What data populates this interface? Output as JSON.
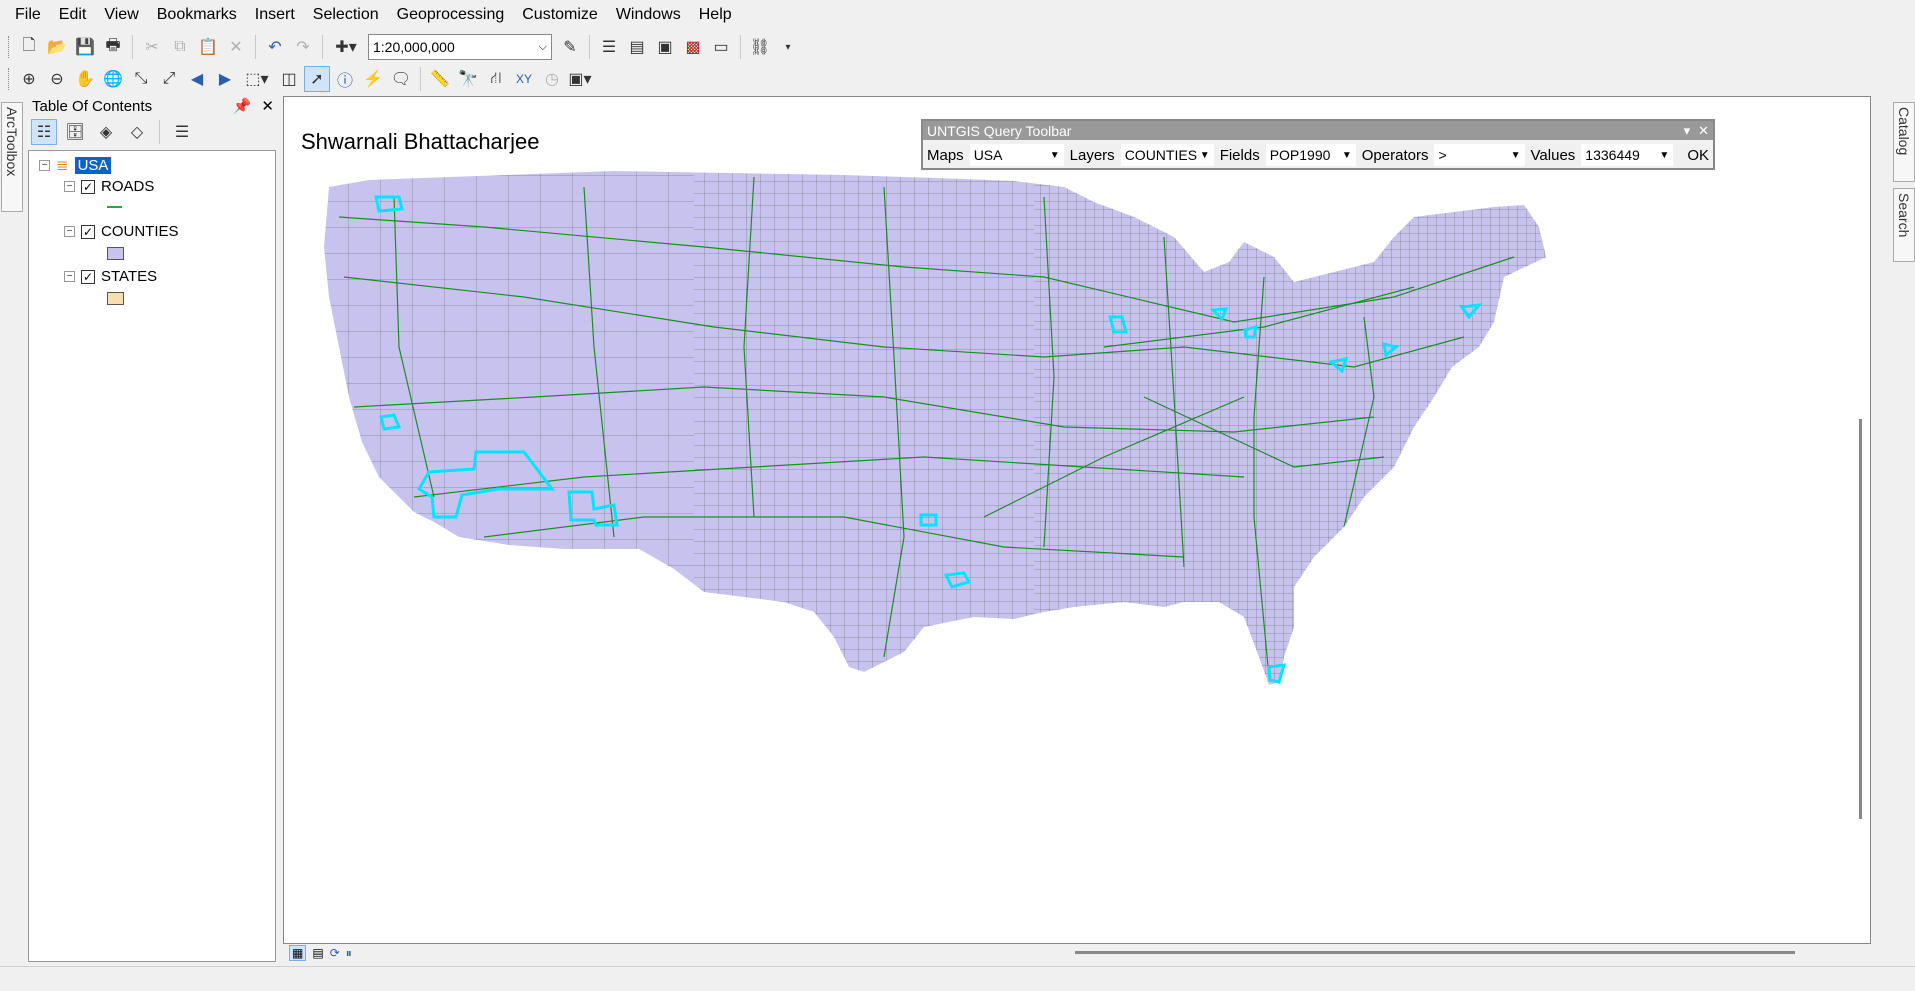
{
  "menu": [
    "File",
    "Edit",
    "View",
    "Bookmarks",
    "Insert",
    "Selection",
    "Geoprocessing",
    "Customize",
    "Windows",
    "Help"
  ],
  "toolbar": {
    "scale": "1:20,000,000"
  },
  "left_dock": {
    "arctoolbox_label": "ArcToolbox"
  },
  "right_dock": {
    "catalog_label": "Catalog",
    "search_label": "Search"
  },
  "toc": {
    "title": "Table Of Contents",
    "root": "USA",
    "layers": [
      {
        "name": "ROADS",
        "checked": true,
        "symbol": "line",
        "color": "#3aa13a"
      },
      {
        "name": "COUNTIES",
        "checked": true,
        "symbol": "fill",
        "color": "#c8c3ee"
      },
      {
        "name": "STATES",
        "checked": true,
        "symbol": "fill",
        "color": "#f7deb0"
      }
    ]
  },
  "map": {
    "title": "Shwarnali Bhattacharjee",
    "county_fill": "#c8c3ee",
    "road_color": "#1f8a2a",
    "selection_color": "#00e5ff"
  },
  "query_toolbar": {
    "title": "UNTGIS Query Toolbar",
    "maps_label": "Maps",
    "maps_value": "USA",
    "layers_label": "Layers",
    "layers_value": "COUNTIES",
    "fields_label": "Fields",
    "fields_value": "POP1990",
    "operators_label": "Operators",
    "operators_value": ">",
    "values_label": "Values",
    "values_value": "1336449",
    "ok_label": "OK"
  }
}
